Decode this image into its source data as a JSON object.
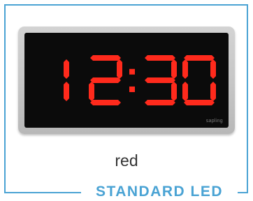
{
  "clock": {
    "time_display": "12:30",
    "digit_color": "#ff2a1c",
    "brand": "sapling"
  },
  "color_label": "red",
  "product_name": "STANDARD LED",
  "accent_color": "#4aa3d4"
}
